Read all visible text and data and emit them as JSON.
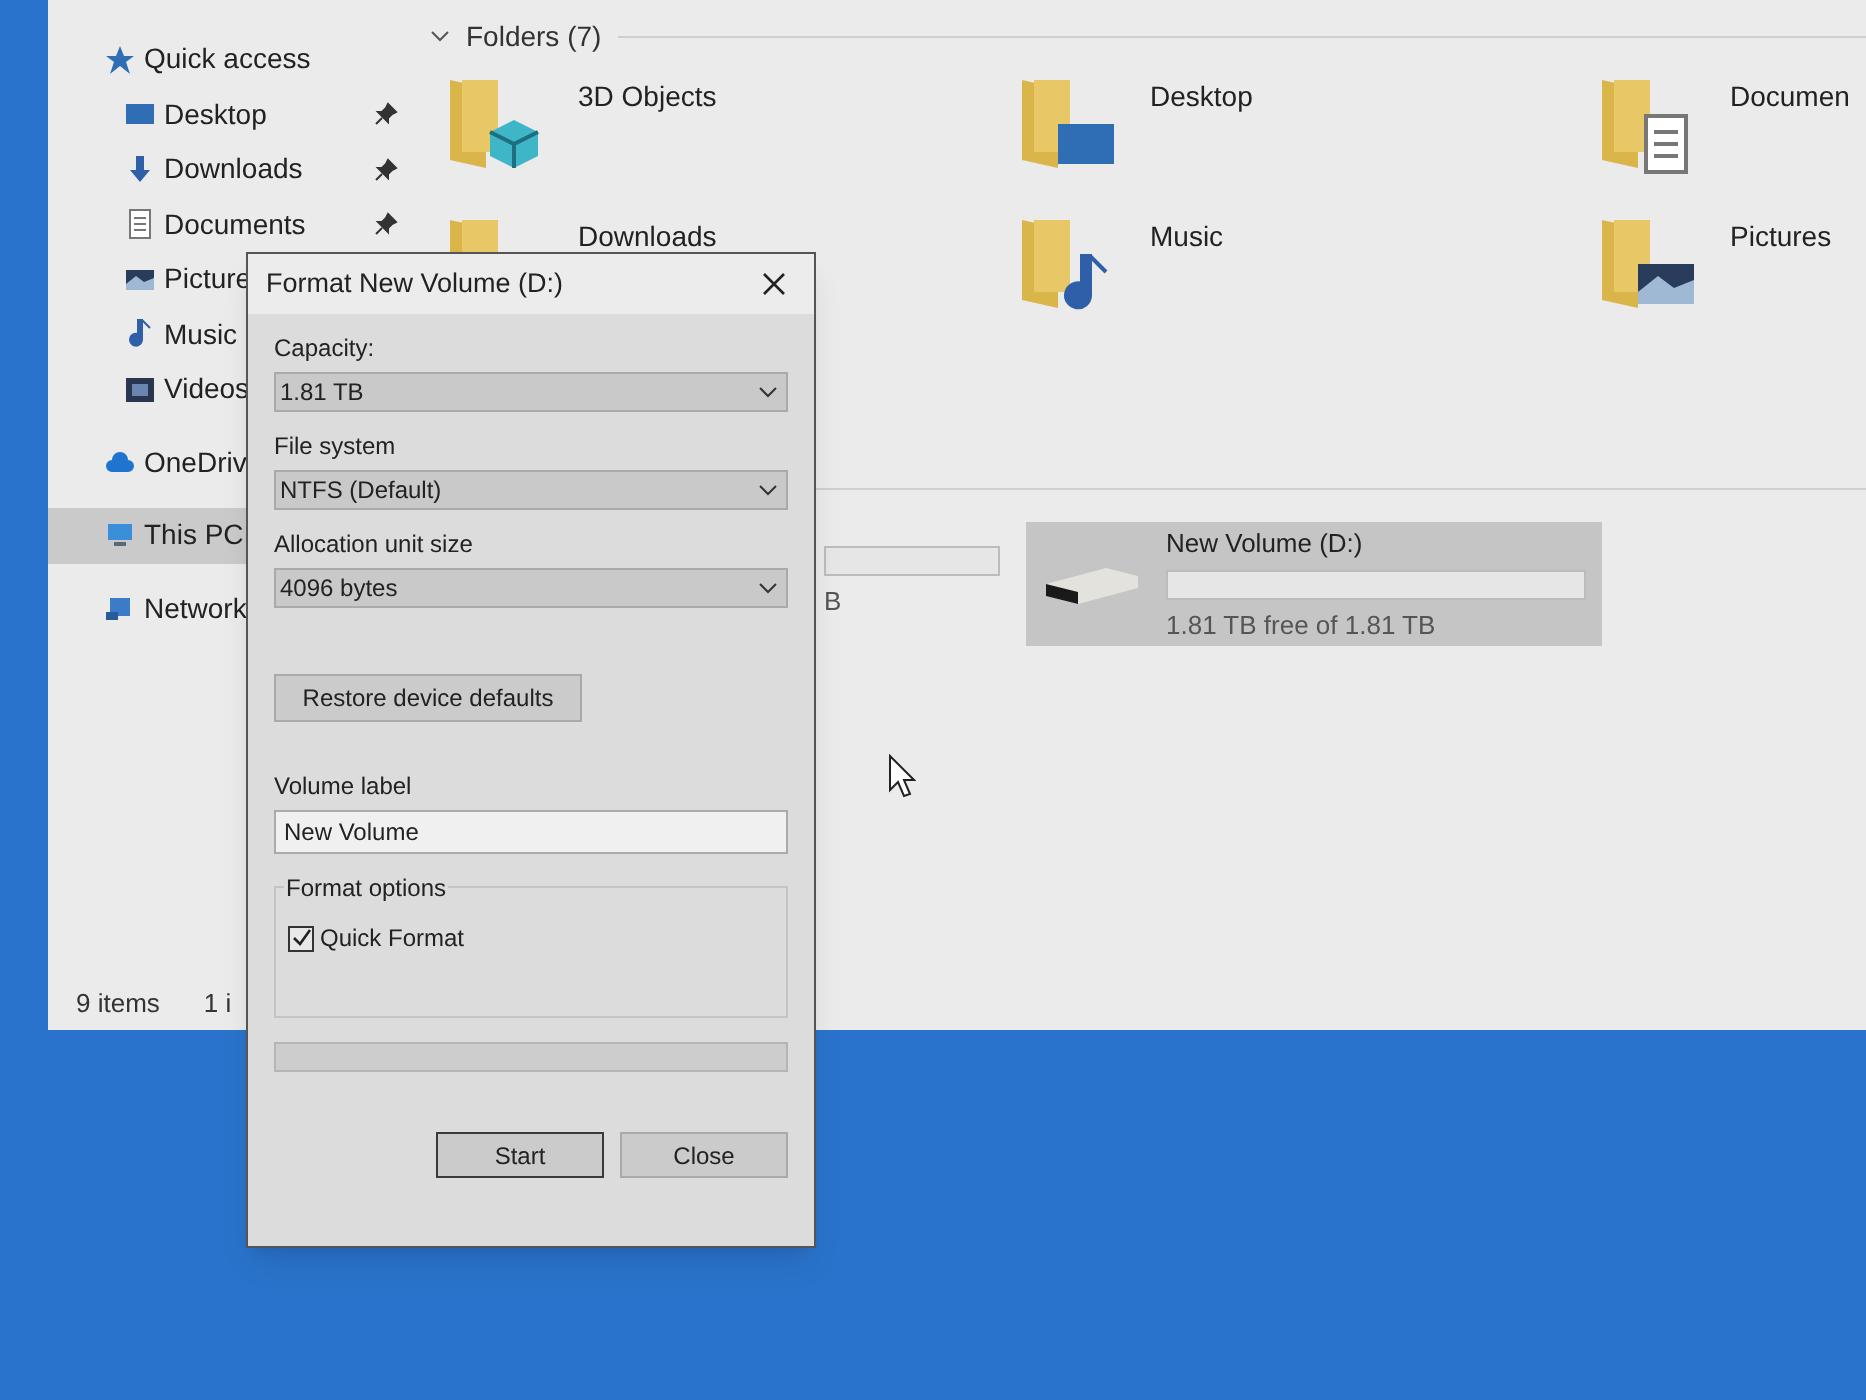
{
  "sidebar": {
    "items": [
      {
        "label": "Quick access",
        "kind": "star",
        "pinned": false,
        "selected": false
      },
      {
        "label": "Desktop",
        "kind": "desktop",
        "pinned": true,
        "selected": false
      },
      {
        "label": "Downloads",
        "kind": "download",
        "pinned": true,
        "selected": false
      },
      {
        "label": "Documents",
        "kind": "document",
        "pinned": true,
        "selected": false
      },
      {
        "label": "Picture",
        "kind": "picture",
        "selected": false
      },
      {
        "label": "Music",
        "kind": "music",
        "selected": false
      },
      {
        "label": "Videos",
        "kind": "video",
        "selected": false
      },
      {
        "label": "OneDriv",
        "kind": "cloud",
        "selected": false
      },
      {
        "label": "This PC",
        "kind": "pc",
        "selected": true
      },
      {
        "label": "Network",
        "kind": "network",
        "selected": false
      }
    ]
  },
  "folders": {
    "heading": "Folders (7)",
    "expanded": true,
    "items": [
      {
        "name": "3D Objects",
        "kind": "cube"
      },
      {
        "name": "Desktop",
        "kind": "desktop"
      },
      {
        "name": "Documen",
        "kind": "document"
      },
      {
        "name": "Downloads",
        "kind": "download"
      },
      {
        "name": "Music",
        "kind": "music"
      },
      {
        "name": "Pictures",
        "kind": "picture"
      }
    ]
  },
  "drives": [
    {
      "free": "B",
      "selected": false
    },
    {
      "name": "New Volume (D:)",
      "level": 0,
      "free": "1.81 TB free of 1.81 TB",
      "selected": true
    }
  ],
  "status_bar": {
    "items": "9 items",
    "selection": "1 i"
  },
  "dialog": {
    "title": "Format New Volume (D:)",
    "fields": [
      {
        "label": "Capacity:",
        "value": "1.81 TB"
      },
      {
        "label": "File system",
        "value": "NTFS (Default)"
      },
      {
        "label": "Allocation unit size",
        "value": "4096 bytes"
      }
    ],
    "restore_button": "Restore device defaults",
    "volume_label": {
      "label": "Volume label",
      "value": "New Volume"
    },
    "format_options": {
      "heading": "Format options",
      "options": [
        {
          "label": "Quick Format",
          "checked": true
        }
      ]
    },
    "progress": {
      "level": 0
    },
    "buttons": [
      {
        "label": "Start",
        "default": true
      },
      {
        "label": "Close",
        "default": false
      }
    ]
  }
}
